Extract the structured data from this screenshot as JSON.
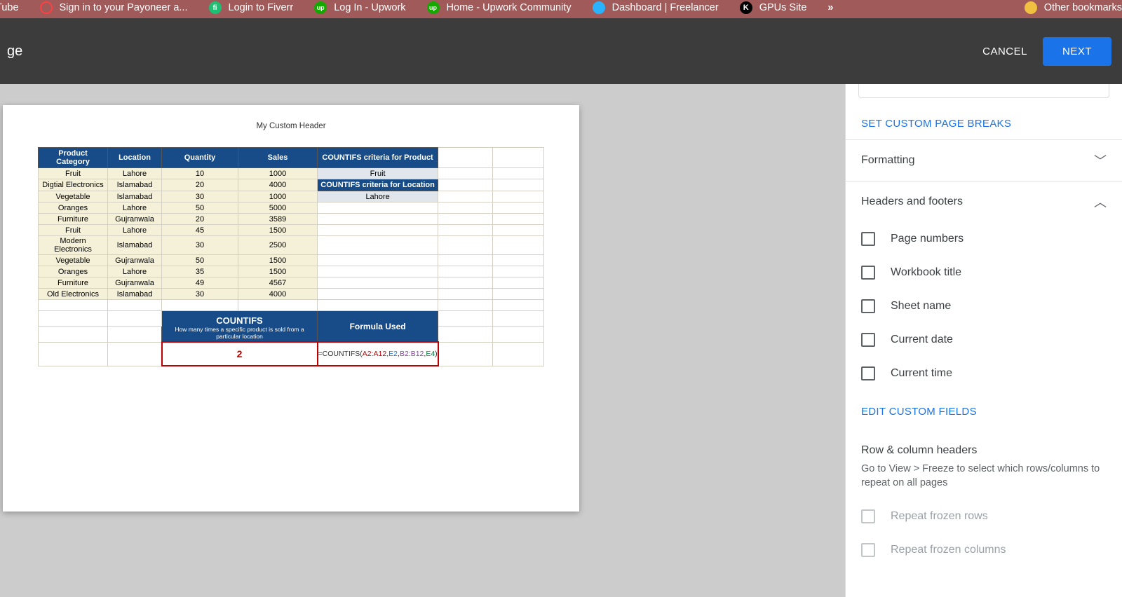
{
  "bookmarks": {
    "items": [
      {
        "label": "Tube"
      },
      {
        "label": "Sign in to your Payoneer a..."
      },
      {
        "label": "Login to Fiverr"
      },
      {
        "label": "Log In - Upwork"
      },
      {
        "label": "Home - Upwork Community"
      },
      {
        "label": "Dashboard | Freelancer"
      },
      {
        "label": "GPUs Site"
      }
    ],
    "other": "Other bookmarks",
    "overflow": "»"
  },
  "topbar": {
    "title_suffix": "ge",
    "cancel": "CANCEL",
    "next": "NEXT"
  },
  "page": {
    "header": "My Custom Header",
    "table": {
      "headers": [
        "Product Category",
        "Location",
        "Quantity",
        "Sales",
        "COUNTIFS criteria for Product"
      ],
      "criteria_product": "Fruit",
      "criteria_location_label": "COUNTIFS criteria for Location",
      "criteria_location": "Lahore",
      "rows": [
        {
          "cat": "Fruit",
          "loc": "Lahore",
          "qty": "10",
          "sales": "1000"
        },
        {
          "cat": "Digtial Electronics",
          "loc": "Islamabad",
          "qty": "20",
          "sales": "4000"
        },
        {
          "cat": "Vegetable",
          "loc": "Islamabad",
          "qty": "30",
          "sales": "1000"
        },
        {
          "cat": "Oranges",
          "loc": "Lahore",
          "qty": "50",
          "sales": "5000"
        },
        {
          "cat": "Furniture",
          "loc": "Gujranwala",
          "qty": "20",
          "sales": "3589"
        },
        {
          "cat": "Fruit",
          "loc": "Lahore",
          "qty": "45",
          "sales": "1500"
        },
        {
          "cat": "Modern Electronics",
          "loc": "Islamabad",
          "qty": "30",
          "sales": "2500"
        },
        {
          "cat": "Vegetable",
          "loc": "Gujranwala",
          "qty": "50",
          "sales": "1500"
        },
        {
          "cat": "Oranges",
          "loc": "Lahore",
          "qty": "35",
          "sales": "1500"
        },
        {
          "cat": "Furniture",
          "loc": "Gujranwala",
          "qty": "49",
          "sales": "4567"
        },
        {
          "cat": "Old Electronics",
          "loc": "Islamabad",
          "qty": "30",
          "sales": "4000"
        }
      ],
      "countifs_title": "COUNTIFS",
      "countifs_sub": "How many times a specific product is sold from a particular location",
      "formula_title": "Formula Used",
      "result": "2",
      "formula": {
        "prefix": "=COUNTIFS(",
        "a": "A2:A12",
        "sep1": ",",
        "b": "E2",
        "sep2": ",",
        "c": "B2:B12",
        "sep3": ",",
        "d": "E4",
        "suffix": ")"
      }
    }
  },
  "panel": {
    "set_breaks": "SET CUSTOM PAGE BREAKS",
    "formatting": "Formatting",
    "headers_footers": "Headers and footers",
    "checks": {
      "page_numbers": "Page numbers",
      "workbook_title": "Workbook title",
      "sheet_name": "Sheet name",
      "current_date": "Current date",
      "current_time": "Current time"
    },
    "edit_custom": "EDIT CUSTOM FIELDS",
    "row_col_headers": "Row & column headers",
    "helper": "Go to View > Freeze to select which rows/columns to repeat on all pages",
    "repeat_rows": "Repeat frozen rows",
    "repeat_cols": "Repeat frozen columns"
  }
}
